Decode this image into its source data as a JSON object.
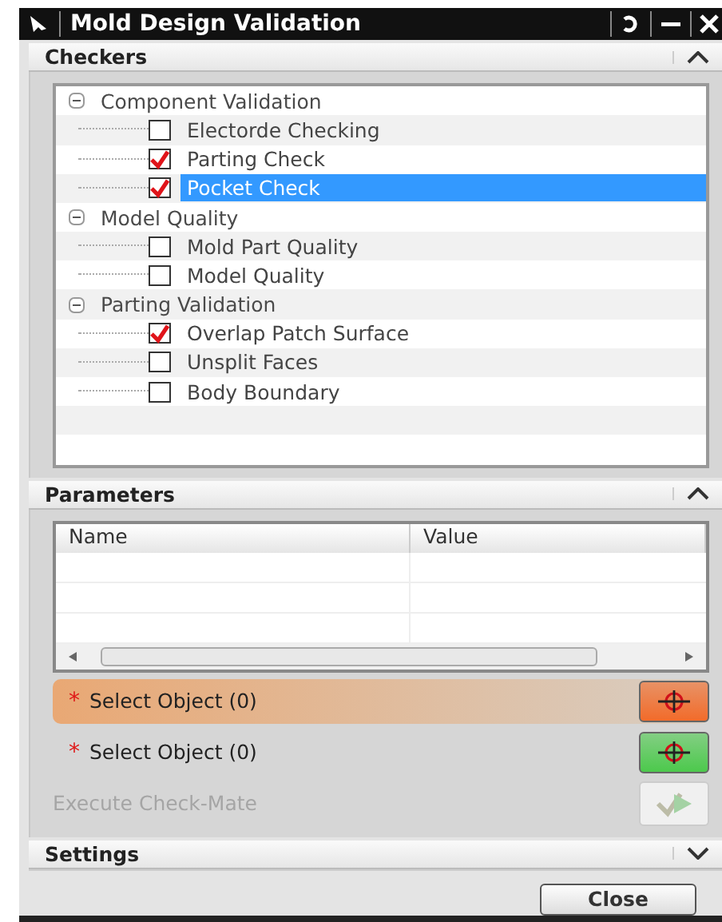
{
  "window": {
    "title": "Mold Design Validation"
  },
  "checkers": {
    "title": "Checkers",
    "expanded": true,
    "tree": [
      {
        "label": "Component Validation",
        "expanded": true,
        "children": [
          {
            "label": "Electorde Checking",
            "checked": false,
            "selected": false
          },
          {
            "label": "Parting Check",
            "checked": true,
            "selected": false
          },
          {
            "label": "Pocket Check",
            "checked": true,
            "selected": true
          }
        ]
      },
      {
        "label": "Model Quality",
        "expanded": true,
        "children": [
          {
            "label": "Mold Part Quality",
            "checked": false,
            "selected": false
          },
          {
            "label": "Model Quality",
            "checked": false,
            "selected": false
          }
        ]
      },
      {
        "label": "Parting Validation",
        "expanded": true,
        "children": [
          {
            "label": "Overlap Patch Surface",
            "checked": true,
            "selected": false
          },
          {
            "label": "Unsplit Faces",
            "checked": false,
            "selected": false
          },
          {
            "label": "Body Boundary",
            "checked": false,
            "selected": false
          }
        ]
      }
    ]
  },
  "parameters": {
    "title": "Parameters",
    "expanded": true,
    "columns": [
      "Name",
      "Value"
    ],
    "selections": [
      {
        "required_mark": "*",
        "label": "Select Object (0)",
        "active": true,
        "color": "#f26b2a"
      },
      {
        "required_mark": "*",
        "label": "Select Object (0)",
        "active": false,
        "color": "#4cc94c"
      }
    ],
    "execute": {
      "label": "Execute Check-Mate",
      "disabled": true
    }
  },
  "settings": {
    "title": "Settings",
    "expanded": false
  },
  "buttons": [
    "Close"
  ]
}
